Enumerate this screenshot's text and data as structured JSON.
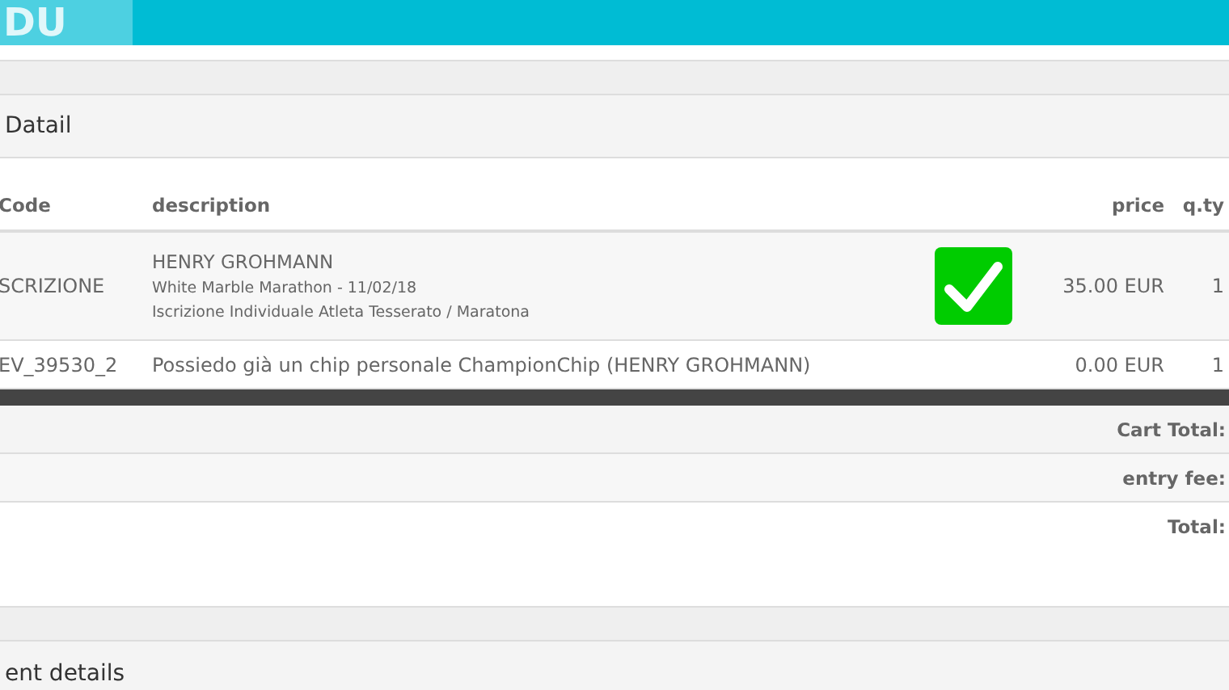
{
  "header": {
    "logo_text": "DU"
  },
  "detail_section": {
    "title": "Datail"
  },
  "table": {
    "columns": [
      "Code",
      "description",
      "price",
      "q.ty"
    ],
    "rows": [
      {
        "code": "SCRIZIONE",
        "lines": [
          "HENRY GROHMANN",
          "White Marble Marathon - 11/02/18",
          "Iscrizione Individuale Atleta Tesserato / Maratona"
        ],
        "confirmed": true,
        "price": "35.00 EUR",
        "qty": "1"
      },
      {
        "code": "EV_39530_2",
        "lines": [
          "Possiedo già un chip personale ChampionChip (HENRY GROHMANN)"
        ],
        "confirmed": false,
        "price": "0.00 EUR",
        "qty": "1"
      }
    ]
  },
  "totals": [
    "Cart Total:",
    "entry fee:",
    "Total:"
  ],
  "next_section": {
    "title": "ent details"
  }
}
